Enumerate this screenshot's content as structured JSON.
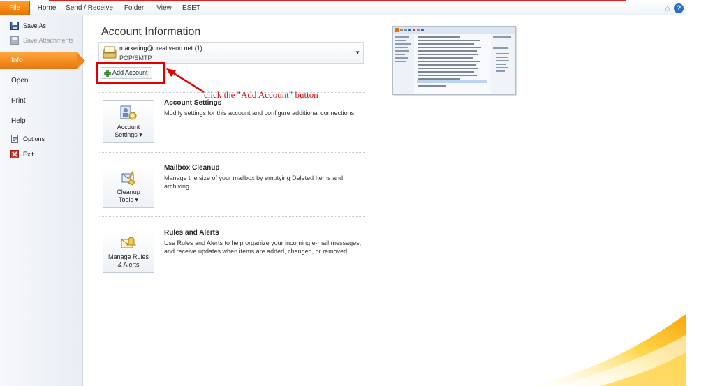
{
  "ribbon": {
    "tabs": [
      "File",
      "Home",
      "Send / Receive",
      "Folder",
      "View",
      "ESET"
    ],
    "minimize_icon": "caret-up",
    "help_icon": "question-mark",
    "help_label": "?"
  },
  "nav": {
    "save_as": "Save As",
    "save_attachments": "Save Attachments",
    "info": "Info",
    "open": "Open",
    "print": "Print",
    "help": "Help",
    "options": "Options",
    "exit": "Exit"
  },
  "main": {
    "title": "Account Information",
    "account": {
      "email": "marketing@creativeon.net (1)",
      "type": "POP/SMTP"
    },
    "add_account_label": "Add Account",
    "sections": [
      {
        "button_line1": "Account",
        "button_line2": "Settings",
        "title": "Account Settings",
        "description": "Modify settings for this account and configure additional connections."
      },
      {
        "button_line1": "Cleanup",
        "button_line2": "Tools",
        "title": "Mailbox Cleanup",
        "description": "Manage the size of your mailbox by emptying Deleted Items and archiving."
      },
      {
        "button_line1": "Manage Rules",
        "button_line2": "& Alerts",
        "title": "Rules and Alerts",
        "description": "Use Rules and Alerts to help organize your incoming e-mail messages, and receive updates when items are added, changed, or removed."
      }
    ]
  },
  "annotation": {
    "text": "click the \"Add Account\" button",
    "color": "#d01010"
  },
  "colors": {
    "file_tab": "#e57200",
    "info_selected": "#f08a1e",
    "highlight": "#e00000"
  }
}
